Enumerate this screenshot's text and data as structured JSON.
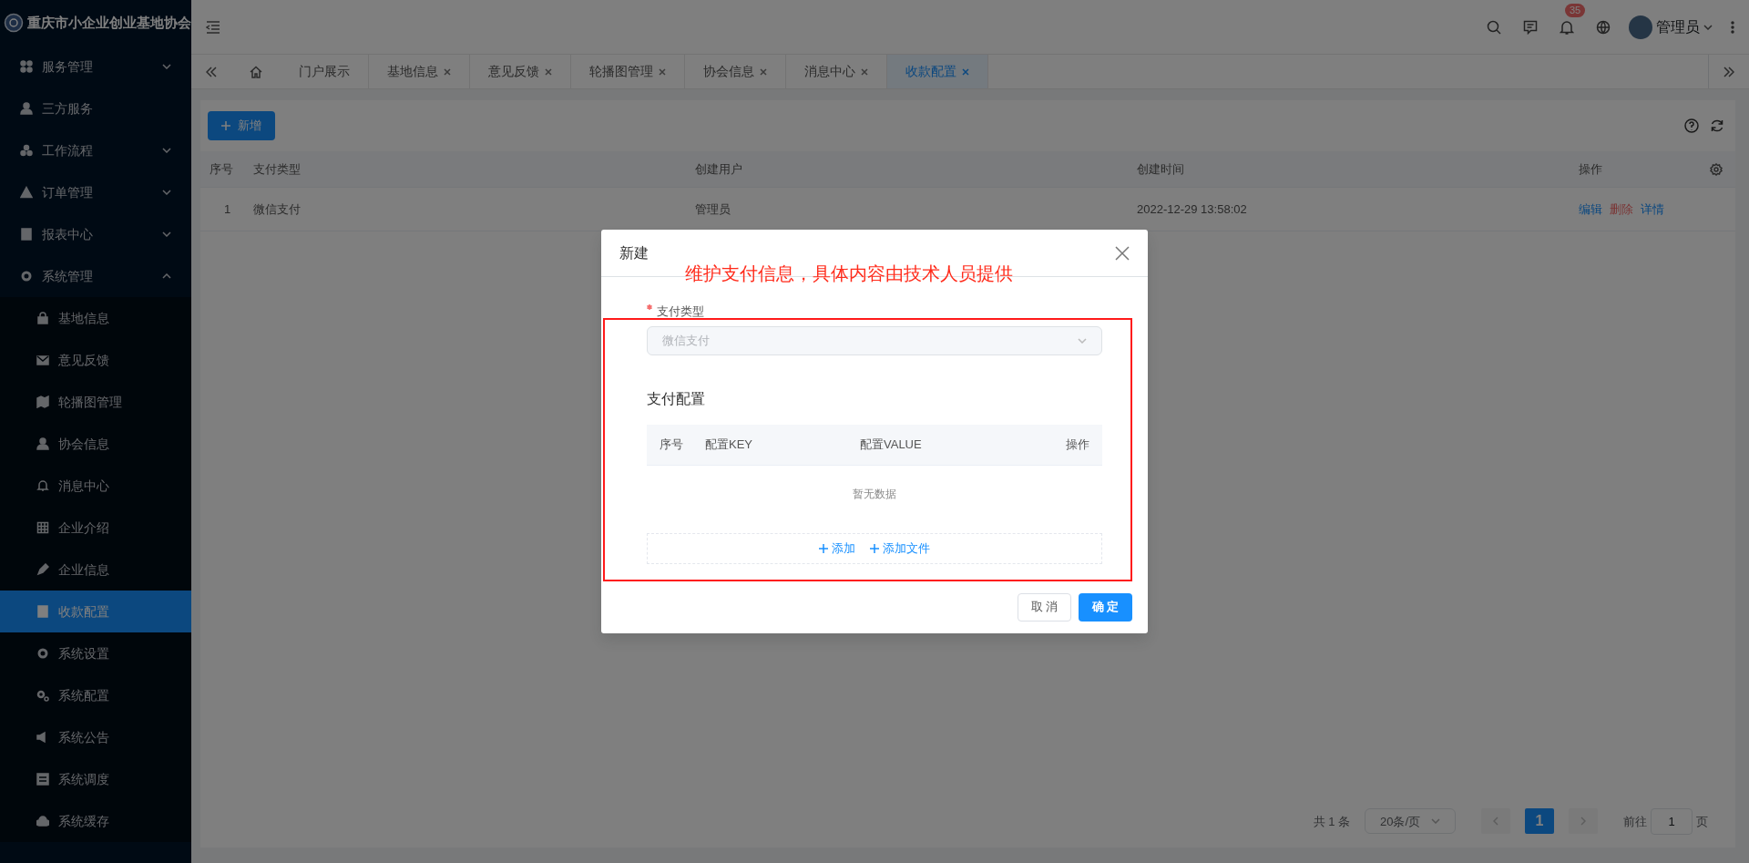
{
  "app": {
    "title": "重庆市小企业创业基地协会"
  },
  "sidebar": {
    "items": [
      {
        "label": "服务管理",
        "kind": "group",
        "expanded": false
      },
      {
        "label": "三方服务",
        "kind": "link"
      },
      {
        "label": "工作流程",
        "kind": "group",
        "expanded": false
      },
      {
        "label": "订单管理",
        "kind": "group",
        "expanded": false
      },
      {
        "label": "报表中心",
        "kind": "group",
        "expanded": false
      },
      {
        "label": "系统管理",
        "kind": "group",
        "expanded": true,
        "children": [
          {
            "label": "基地信息",
            "selected": false
          },
          {
            "label": "意见反馈",
            "selected": false
          },
          {
            "label": "轮播图管理",
            "selected": false
          },
          {
            "label": "协会信息",
            "selected": false
          },
          {
            "label": "消息中心",
            "selected": false
          },
          {
            "label": "企业介绍",
            "selected": false
          },
          {
            "label": "企业信息",
            "selected": false
          },
          {
            "label": "收款配置",
            "selected": true
          },
          {
            "label": "系统设置",
            "selected": false
          },
          {
            "label": "系统配置",
            "selected": false
          },
          {
            "label": "系统公告",
            "selected": false
          },
          {
            "label": "系统调度",
            "selected": false
          },
          {
            "label": "系统缓存",
            "selected": false
          }
        ]
      }
    ]
  },
  "header": {
    "notification_count": "35",
    "user": "管理员"
  },
  "tabs": [
    {
      "label": "门户展示",
      "closable": false,
      "selected": false
    },
    {
      "label": "基地信息",
      "closable": true,
      "selected": false
    },
    {
      "label": "意见反馈",
      "closable": true,
      "selected": false
    },
    {
      "label": "轮播图管理",
      "closable": true,
      "selected": false
    },
    {
      "label": "协会信息",
      "closable": true,
      "selected": false
    },
    {
      "label": "消息中心",
      "closable": true,
      "selected": false
    },
    {
      "label": "收款配置",
      "closable": true,
      "selected": true
    }
  ],
  "toolbar": {
    "new_button": "新增"
  },
  "table": {
    "columns": [
      "序号",
      "支付类型",
      "创建用户",
      "创建时间",
      "操作"
    ],
    "rows": [
      {
        "index": "1",
        "type": "微信支付",
        "user": "管理员",
        "time": "2022-12-29 13:58:02",
        "actions": [
          {
            "label": "编辑",
            "kind": "normal"
          },
          {
            "label": "删除",
            "kind": "danger"
          },
          {
            "label": "详情",
            "kind": "normal"
          }
        ]
      }
    ]
  },
  "pagination": {
    "total": "共 1 条",
    "page_size": "20条/页",
    "pages": [
      {
        "label": "1",
        "selected": true
      }
    ],
    "goto_label": "前往",
    "goto_value": "1",
    "goto_suffix": "页"
  },
  "modal": {
    "title": "新建",
    "annotation": "维护支付信息，具体内容由技术人员提供",
    "field": {
      "label": "支付类型",
      "required": true,
      "value": "微信支付",
      "disabled": true
    },
    "section_title": "支付配置",
    "columns": [
      "序号",
      "配置KEY",
      "配置VALUE",
      "操作"
    ],
    "empty_text": "暂无数据",
    "add_actions": [
      "添加",
      "添加文件"
    ],
    "buttons": [
      {
        "label": "取 消",
        "primary": false
      },
      {
        "label": "确 定",
        "primary": true
      }
    ]
  }
}
